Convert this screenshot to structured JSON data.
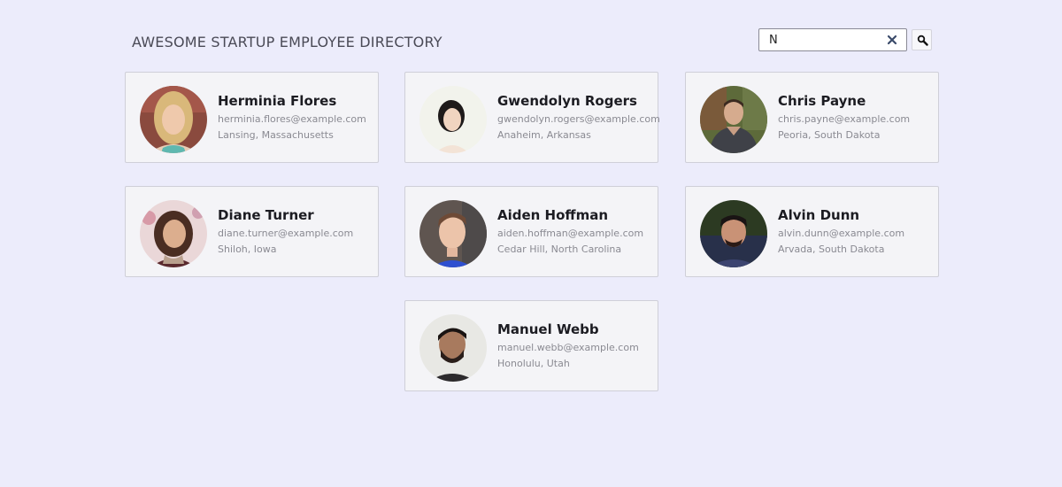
{
  "header": {
    "title": "AWESOME STARTUP EMPLOYEE DIRECTORY"
  },
  "search": {
    "value": "N",
    "clear_icon": "close-icon",
    "button_icon": "magnifier-icon"
  },
  "employees": [
    {
      "name": "Herminia Flores",
      "email": "herminia.flores@example.com",
      "location": "Lansing, Massachusetts"
    },
    {
      "name": "Gwendolyn Rogers",
      "email": "gwendolyn.rogers@example.com",
      "location": "Anaheim, Arkansas"
    },
    {
      "name": "Chris Payne",
      "email": "chris.payne@example.com",
      "location": "Peoria, South Dakota"
    },
    {
      "name": "Diane Turner",
      "email": "diane.turner@example.com",
      "location": "Shiloh, Iowa"
    },
    {
      "name": "Aiden Hoffman",
      "email": "aiden.hoffman@example.com",
      "location": "Cedar Hill, North Carolina"
    },
    {
      "name": "Alvin Dunn",
      "email": "alvin.dunn@example.com",
      "location": "Arvada, South Dakota"
    },
    {
      "name": "Manuel Webb",
      "email": "manuel.webb@example.com",
      "location": "Honolulu, Utah"
    }
  ],
  "colors": {
    "background": "#ececfb",
    "card": "#f4f4f7",
    "clear_icon": "#3a4a6a"
  }
}
